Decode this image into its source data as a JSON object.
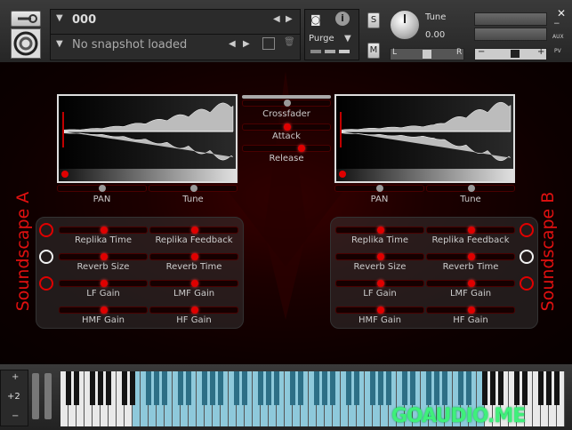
{
  "header": {
    "instrument_name": "000",
    "snapshot": "No snapshot loaded",
    "purge_label": "Purge",
    "tune_label": "Tune",
    "tune_value": "0.00",
    "solo_label": "S",
    "mute_label": "M",
    "pan_left": "L",
    "pan_right": "R",
    "vol_minus": "−",
    "vol_plus": "+",
    "aux_label": "AUX",
    "pv_label": "PV",
    "info_label": "i",
    "minimize_label": "−"
  },
  "center": {
    "crossfader_label": "Crossfader",
    "attack_label": "Attack",
    "release_label": "Release"
  },
  "soundscape_a": {
    "title": "Soundscape A",
    "pan_label": "PAN",
    "tune_label": "Tune",
    "params": [
      "Replika Time",
      "Replika Feedback",
      "Reverb Size",
      "Reverb Time",
      "LF Gain",
      "LMF Gain",
      "HMF Gain",
      "HF Gain"
    ]
  },
  "soundscape_b": {
    "title": "Soundscape B",
    "pan_label": "PAN",
    "tune_label": "Tune",
    "params": [
      "Replika Time",
      "Replika Feedback",
      "Reverb Size",
      "Reverb Time",
      "LF Gain",
      "LMF Gain",
      "HMF Gain",
      "HF Gain"
    ]
  },
  "keyboard": {
    "octave_value": "+2",
    "octave_plus": "+",
    "octave_minus": "−"
  },
  "watermark": "GOAUDIO.ME",
  "colors": {
    "accent": "#e00000",
    "highlight_key": "#8ec9db",
    "watermark": "#3ff07a"
  }
}
